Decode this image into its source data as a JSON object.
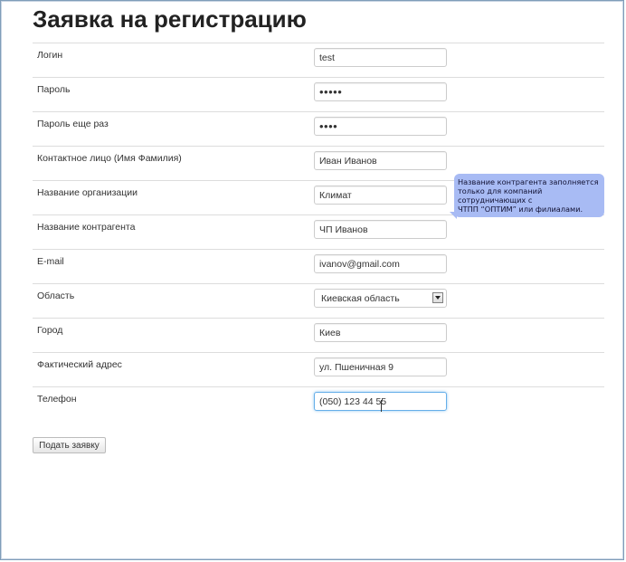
{
  "page": {
    "title": "Заявка на регистрацию"
  },
  "form": {
    "login": {
      "label": "Логин",
      "value": "test"
    },
    "password": {
      "label": "Пароль",
      "value": "•••••"
    },
    "password_repeat": {
      "label": "Пароль еще раз",
      "value": "••••"
    },
    "contact": {
      "label": "Контактное лицо (Имя Фамилия)",
      "value": "Иван Иванов"
    },
    "organization": {
      "label": "Название организации",
      "value": "Климат"
    },
    "counterparty": {
      "label": "Название контрагента",
      "value": "ЧП Иванов"
    },
    "email": {
      "label": "E-mail",
      "value": "ivanov@gmail.com"
    },
    "region": {
      "label": "Область",
      "selected": "Киевская область"
    },
    "city": {
      "label": "Город",
      "value": "Киев"
    },
    "address": {
      "label": "Фактический адрес",
      "value": "ул. Пшеничная 9"
    },
    "phone": {
      "label": "Телефон",
      "value": "(050) 123 44 55"
    },
    "submit_label": "Подать заявку"
  },
  "tooltip": {
    "text": "Название контрагента заполняется\nтолько для компаний\nсотрудничающих с\nЧТПП “ОПТИМ” или филиалами."
  }
}
